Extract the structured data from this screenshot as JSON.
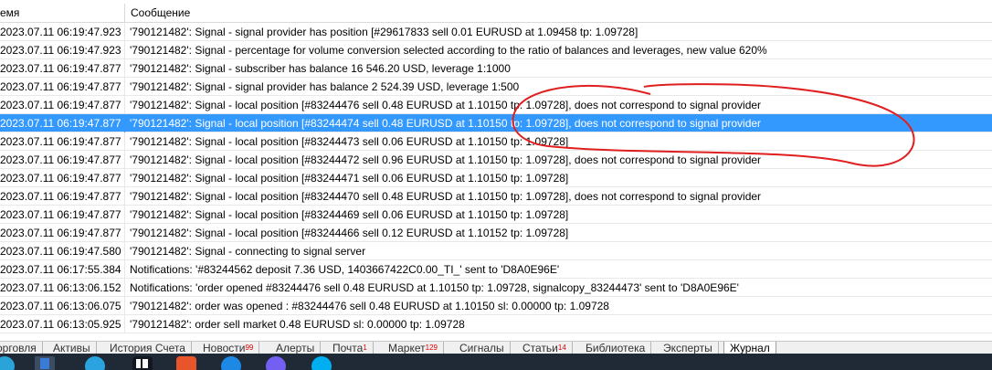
{
  "header": {
    "time_col": "емя",
    "message_col": "Сообщение"
  },
  "rows": [
    {
      "time": "2023.07.11 06:19:47.923",
      "message": "'790121482': Signal - signal provider has position [#29617833 sell 0.01 EURUSD at 1.09458 tp: 1.09728]"
    },
    {
      "time": "2023.07.11 06:19:47.923",
      "message": "'790121482': Signal - percentage for volume conversion selected according to the ratio of balances and leverages, new value 620%"
    },
    {
      "time": "2023.07.11 06:19:47.877",
      "message": "'790121482': Signal - subscriber has balance 16 546.20 USD, leverage 1:1000"
    },
    {
      "time": "2023.07.11 06:19:47.877",
      "message": "'790121482': Signal - signal provider has balance 2 524.39 USD, leverage 1:500"
    },
    {
      "time": "2023.07.11 06:19:47.877",
      "message": "'790121482': Signal - local position [#83244476 sell 0.48 EURUSD at 1.10150 tp: 1.09728], does not correspond to signal provider"
    },
    {
      "time": "2023.07.11 06:19:47.877",
      "message": "'790121482': Signal - local position [#83244474 sell 0.48 EURUSD at 1.10150 tp: 1.09728], does not correspond to signal provider"
    },
    {
      "time": "2023.07.11 06:19:47.877",
      "message": "'790121482': Signal - local position [#83244473 sell 0.06 EURUSD at 1.10150 tp: 1.09728]"
    },
    {
      "time": "2023.07.11 06:19:47.877",
      "message": "'790121482': Signal - local position [#83244472 sell 0.96 EURUSD at 1.10150 tp: 1.09728], does not correspond to signal provider"
    },
    {
      "time": "2023.07.11 06:19:47.877",
      "message": "'790121482': Signal - local position [#83244471 sell 0.06 EURUSD at 1.10150 tp: 1.09728]"
    },
    {
      "time": "2023.07.11 06:19:47.877",
      "message": "'790121482': Signal - local position [#83244470 sell 0.48 EURUSD at 1.10150 tp: 1.09728], does not correspond to signal provider"
    },
    {
      "time": "2023.07.11 06:19:47.877",
      "message": "'790121482': Signal - local position [#83244469 sell 0.06 EURUSD at 1.10150 tp: 1.09728]"
    },
    {
      "time": "2023.07.11 06:19:47.877",
      "message": "'790121482': Signal - local position [#83244466 sell 0.12 EURUSD at 1.10152 tp: 1.09728]"
    },
    {
      "time": "2023.07.11 06:19:47.580",
      "message": "'790121482': Signal - connecting to signal server"
    },
    {
      "time": "2023.07.11 06:17:55.384",
      "message": "Notifications: '#83244562 deposit 7.36 USD, 1403667422C0.00_TI_' sent to 'D8A0E96E'"
    },
    {
      "time": "2023.07.11 06:13:06.152",
      "message": "Notifications: 'order opened #83244476 sell 0.48 EURUSD at 1.10150 tp: 1.09728, signalcopy_83244473' sent to 'D8A0E96E'"
    },
    {
      "time": "2023.07.11 06:13:06.075",
      "message": "'790121482': order was opened : #83244476 sell 0.48 EURUSD at 1.10150 sl: 0.00000 tp: 1.09728"
    },
    {
      "time": "2023.07.11 06:13:05.925",
      "message": "'790121482': order sell market 0.48 EURUSD sl: 0.00000 tp: 1.09728"
    }
  ],
  "selected_row_index": 5,
  "tabs": [
    {
      "label": "орговля",
      "badge": ""
    },
    {
      "label": "Активы",
      "badge": ""
    },
    {
      "label": "История Счета",
      "badge": ""
    },
    {
      "label": "Новости",
      "badge": "99"
    },
    {
      "label": "Алерты",
      "badge": ""
    },
    {
      "label": "Почта",
      "badge": "1"
    },
    {
      "label": "Маркет",
      "badge": "129"
    },
    {
      "label": "Сигналы",
      "badge": ""
    },
    {
      "label": "Статьи",
      "badge": "14"
    },
    {
      "label": "Библиотека",
      "badge": ""
    },
    {
      "label": "Эксперты",
      "badge": ""
    },
    {
      "label": "Журнал",
      "badge": ""
    }
  ],
  "active_tab": "Журнал",
  "taskbar_icons": [
    "browser-icon",
    "file-explorer-icon",
    "telegram-icon",
    "tradingview-icon",
    "app-icon",
    "network-icon",
    "viber-icon",
    "skype-icon"
  ],
  "colors": {
    "selection": "#3399ff",
    "annotation": "#e02020",
    "taskbar": "#202a36"
  }
}
